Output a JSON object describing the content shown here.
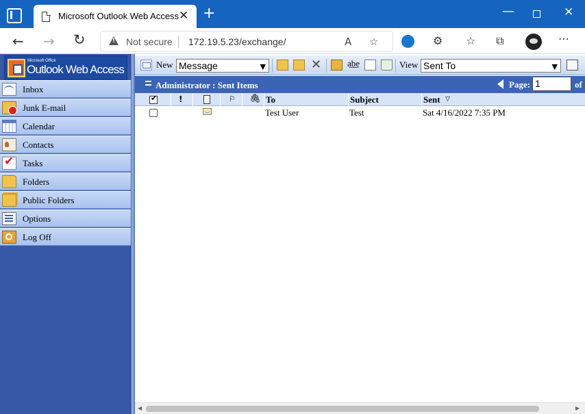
{
  "browser": {
    "tab_title": "Microsoft Outlook Web Access",
    "close_glyph": "✕",
    "new_tab_glyph": "+",
    "security_label": "Not secure",
    "url": "172.19.5.23/exchange/",
    "icons": {
      "back": "←",
      "forward": "→",
      "reload": "↻",
      "read_aloud": "A",
      "add_favorite": "☆",
      "extensions": "⚙",
      "favorites": "☆",
      "collections": "⧉",
      "more": "⋯",
      "minimize": "—",
      "close": "✕"
    }
  },
  "owa": {
    "logo_small": "Microsoft Office",
    "logo_text": "Outlook Web Access",
    "nav": [
      {
        "label": "Inbox"
      },
      {
        "label": "Junk E-mail"
      },
      {
        "label": "Calendar"
      },
      {
        "label": "Contacts"
      },
      {
        "label": "Tasks"
      },
      {
        "label": "Folders"
      },
      {
        "label": "Public Folders"
      },
      {
        "label": "Options"
      },
      {
        "label": "Log Off"
      }
    ],
    "toolbar": {
      "new_label": "New",
      "new_selected": "Message",
      "check_glyph": "a͟b͟e",
      "delete_glyph": "✕",
      "view_label": "View",
      "view_selected": "Sent To",
      "caret": "▼"
    },
    "folder": {
      "title": "Administrator : Sent Items",
      "page_label": "Page:",
      "page_value": "1",
      "of_label": "of"
    },
    "columns": {
      "importance": "!",
      "flag": "⚐",
      "attachment": "🖇",
      "to": "To",
      "subject": "Subject",
      "sent": "Sent",
      "sort": "▽"
    },
    "rows": [
      {
        "to": "Test User",
        "subject": "Test",
        "sent": "Sat 4/16/2022 7:35 PM"
      }
    ],
    "scroll": {
      "left": "◀",
      "right": "▶"
    }
  }
}
